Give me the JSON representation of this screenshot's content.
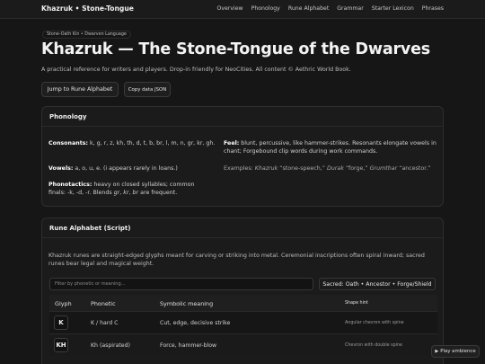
{
  "nav": {
    "brand": "Khazruk • Stone-Tongue",
    "links": [
      "Overview",
      "Phonology",
      "Rune Alphabet",
      "Grammar",
      "Starter Lexicon",
      "Phrases"
    ]
  },
  "hero": {
    "breadcrumb": "Stone-Oath Kin • Dwarven Language",
    "title": "Khazruk — The Stone-Tongue of the Dwarves",
    "subtitle": "A practical reference for writers and players. Drop-in friendly for NeoCities. All content © Aethric World Book.",
    "jump_label": "Jump to Rune Alphabet",
    "copy_label": "Copy data JSON"
  },
  "phonology": {
    "heading": "Phonology",
    "consonants_label": "Consonants:",
    "consonants": " k, g, r, z, kh, th, d, t, b, br, l, m, n, gr, kr, gh.",
    "vowels_label": "Vowels:",
    "vowels": " a, o, u, e. (i appears rarely in loans.)",
    "phonotactics_label": "Phonotactics:",
    "phonotactics_a": " heavy on closed syllables; common finals: -k, -d, -r. Blends ",
    "phonotactics_b1": "gr",
    "phonotactics_sep": ", ",
    "phonotactics_b2": "kr",
    "phonotactics_sep2": ", ",
    "phonotactics_b3": "br",
    "phonotactics_end": " are frequent.",
    "feel_label": "Feel:",
    "feel": " blunt, percussive, like hammer-strikes. Resonants elongate vowels in chant; Forgebound clip words during work commands.",
    "examples_lead": "Examples: ",
    "ex1_word": "Khazruk",
    "ex1_gloss": " “stone-speech,” ",
    "ex2_word": "Durak",
    "ex2_gloss": " “forge,” ",
    "ex3_word": "Grumthar",
    "ex3_gloss": " “ancestor.”"
  },
  "runes": {
    "heading": "Rune Alphabet (Script)",
    "description": "Khazruk runes are straight-edged glyphs meant for carving or striking into metal. Ceremonial inscriptions often spiral inward; sacred runes bear legal and magical weight.",
    "filter_placeholder": "Filter by phonetic or meaning...",
    "sacred": "Sacred: Oath • Ancestor • Forge/Shield",
    "columns": [
      "Glyph",
      "Phonetic",
      "Symbolic meaning",
      "Shape hint"
    ],
    "rows": [
      {
        "glyph": "K",
        "phonetic": "K / hard C",
        "meaning": "Cut, edge, decisive strike",
        "hint": "Angular chevron with spine"
      },
      {
        "glyph": "KH",
        "phonetic": "Kh (aspirated)",
        "meaning": "Force, hammer-blow",
        "hint": "Chevron with double spine"
      }
    ]
  },
  "ambience_label": "Play ambience"
}
